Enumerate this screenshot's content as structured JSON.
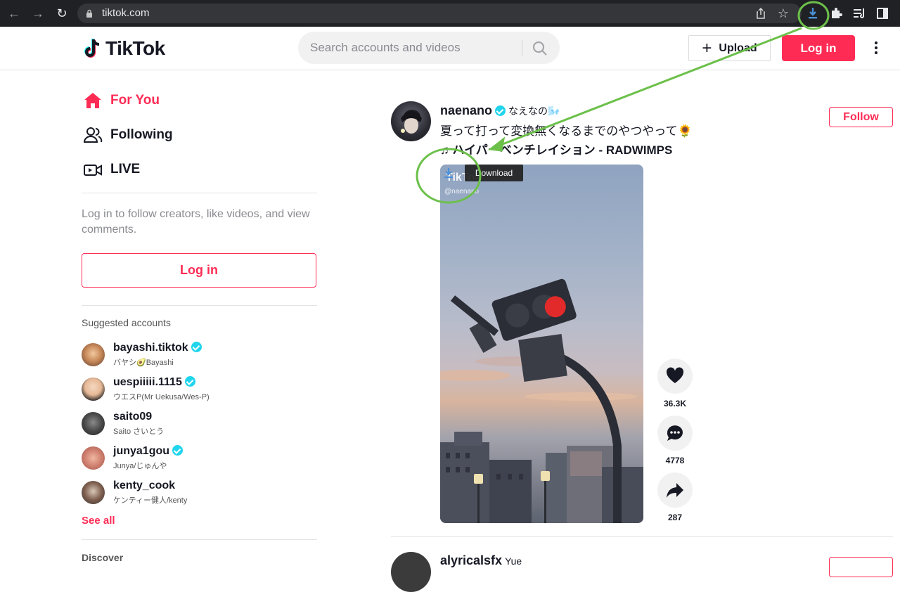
{
  "browser": {
    "url": "tiktok.com",
    "back_icon": "arrow-left-icon",
    "forward_icon": "arrow-right-icon",
    "reload_icon": "reload-icon"
  },
  "header": {
    "logo_text": "TikTok",
    "search_placeholder": "Search accounts and videos",
    "upload_label": "Upload",
    "login_label": "Log in"
  },
  "sidebar": {
    "nav": [
      {
        "label": "For You",
        "icon": "home-icon",
        "active": true
      },
      {
        "label": "Following",
        "icon": "people-icon",
        "active": false
      },
      {
        "label": "LIVE",
        "icon": "live-video-icon",
        "active": false
      }
    ],
    "login_prompt": "Log in to follow creators, like videos, and view comments.",
    "login_button": "Log in",
    "suggested_title": "Suggested accounts",
    "accounts": [
      {
        "username": "bayashi.tiktok",
        "nickname": "バヤシ🥑Bayashi",
        "verified": true
      },
      {
        "username": "uespiiiii.1115",
        "nickname": "ウエスP(Mr Uekusa/Wes-P)",
        "verified": true
      },
      {
        "username": "saito09",
        "nickname": "Saito さいとう",
        "verified": false
      },
      {
        "username": "junya1gou",
        "nickname": "Junya/じゅんや",
        "verified": true
      },
      {
        "username": "kenty_cook",
        "nickname": "ケンティー健人/kenty",
        "verified": false
      }
    ],
    "see_all": "See all",
    "discover_title": "Discover"
  },
  "post": {
    "username": "naenano",
    "nickname": "なえなの🌬️",
    "caption": "夏って打って変換無くなるまでのやつやって🌻",
    "music": "♫ ハイパーベンチレイション - RADWIMPS",
    "follow_label": "Follow",
    "video_watermark": "TikTok",
    "video_handle": "@naenano",
    "download_tooltip": "Download",
    "likes": "36.3K",
    "comments": "4778",
    "shares": "287"
  },
  "next_post": {
    "username": "alyricalsfx",
    "nickname": "Yue"
  },
  "colors": {
    "brand": "#fe2c55",
    "verified": "#20d5ec",
    "annotation": "#6cc04a",
    "extension_icon": "#4a90d9"
  }
}
